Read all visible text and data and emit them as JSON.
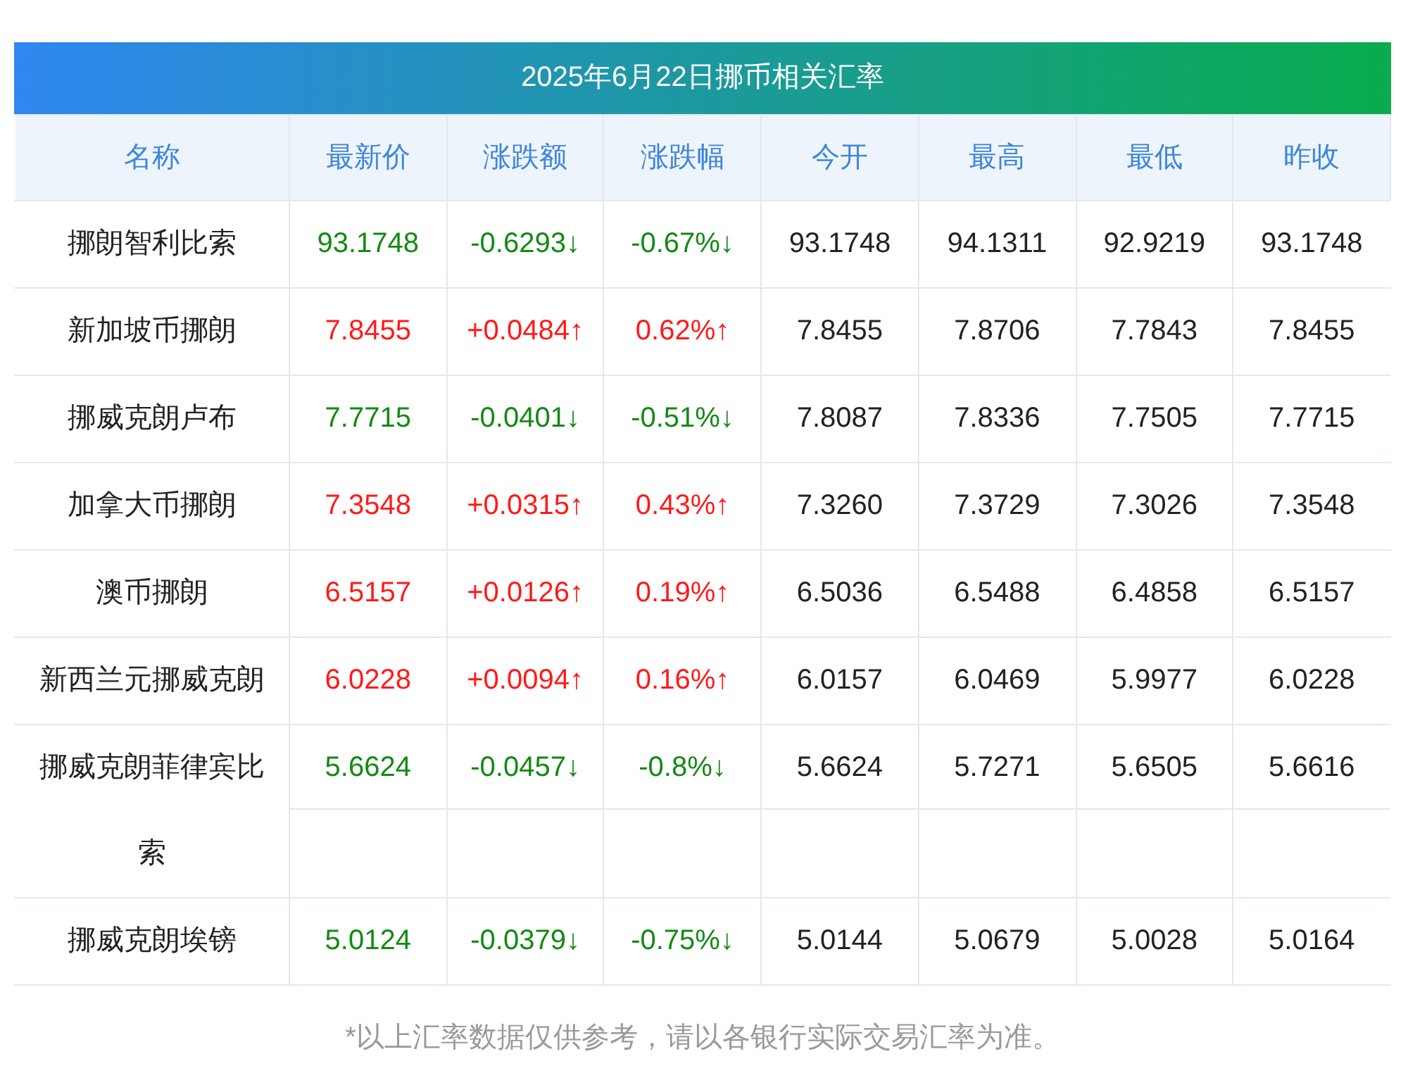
{
  "title": "2025年6月22日挪币相关汇率",
  "columns": [
    "名称",
    "最新价",
    "涨跌额",
    "涨跌幅",
    "今开",
    "最高",
    "最低",
    "昨收"
  ],
  "rows": [
    {
      "name": "挪朗智利比索",
      "color": "#138a13",
      "latest": "93.1748",
      "change": "-0.6293↓",
      "percent": "-0.67%↓",
      "open": "93.1748",
      "high": "94.1311",
      "low": "92.9219",
      "prev": "93.1748"
    },
    {
      "name": "新加坡币挪朗",
      "color": "#ff1a1a",
      "latest": "7.8455",
      "change": "+0.0484↑",
      "percent": "0.62%↑",
      "open": "7.8455",
      "high": "7.8706",
      "low": "7.7843",
      "prev": "7.8455"
    },
    {
      "name": "挪威克朗卢布",
      "color": "#138a13",
      "latest": "7.7715",
      "change": "-0.0401↓",
      "percent": "-0.51%↓",
      "open": "7.8087",
      "high": "7.8336",
      "low": "7.7505",
      "prev": "7.7715"
    },
    {
      "name": "加拿大币挪朗",
      "color": "#ff1a1a",
      "latest": "7.3548",
      "change": "+0.0315↑",
      "percent": "0.43%↑",
      "open": "7.3260",
      "high": "7.3729",
      "low": "7.3026",
      "prev": "7.3548"
    },
    {
      "name": "澳币挪朗",
      "color": "#ff1a1a",
      "latest": "6.5157",
      "change": "+0.0126↑",
      "percent": "0.19%↑",
      "open": "6.5036",
      "high": "6.5488",
      "low": "6.4858",
      "prev": "6.5157"
    },
    {
      "name": "新西兰元挪威克朗",
      "color": "#ff1a1a",
      "latest": "6.0228",
      "change": "+0.0094↑",
      "percent": "0.16%↑",
      "open": "6.0157",
      "high": "6.0469",
      "low": "5.9977",
      "prev": "6.0228"
    },
    {
      "name": "挪威克朗菲律宾比索",
      "color": "#138a13",
      "latest": "5.6624",
      "change": "-0.0457↓",
      "percent": "-0.8%↓",
      "open": "5.6624",
      "high": "5.7271",
      "low": "5.6505",
      "prev": "5.6616"
    },
    {
      "name": "挪威克朗埃镑",
      "color": "#138a13",
      "latest": "5.0124",
      "change": "-0.0379↓",
      "percent": "-0.75%↓",
      "open": "5.0144",
      "high": "5.0679",
      "low": "5.0028",
      "prev": "5.0164"
    }
  ],
  "footnote": "*以上汇率数据仅供参考，请以各银行实际交易汇率为准。"
}
